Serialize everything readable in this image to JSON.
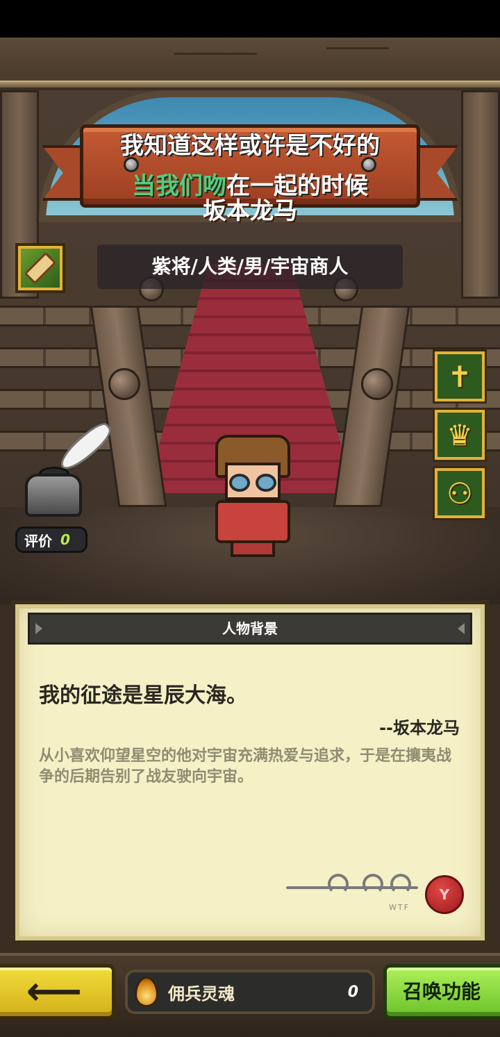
{
  "lyrics": {
    "line1": "我知道这样或许是不好的",
    "line2_highlight": "当我们吻",
    "line2_rest": "在一起的时候"
  },
  "hero": {
    "name": "坂本龙马",
    "info": "紫将/人类/男/宇宙商人"
  },
  "rating": {
    "label": "评价",
    "value": "0"
  },
  "side_icons": [
    {
      "icon": "cross-staff-icon"
    },
    {
      "icon": "crown-up-icon"
    },
    {
      "icon": "goggles-icon"
    }
  ],
  "background_panel": {
    "title": "人物背景",
    "quote": "我的征途是星辰大海。",
    "author": "--坂本龙马",
    "bio": "从小喜欢仰望星空的他对宇宙充满热爱与追求，于是在攘夷战争的后期告别了战友驶向宇宙。",
    "signature_tag": "WTF",
    "seal_letter": "Y"
  },
  "bottom": {
    "soul_label": "佣兵灵魂",
    "soul_value": "0",
    "summon_label": "召唤功能"
  },
  "colors": {
    "lyric_highlight": "#4fd07a",
    "summon_button": "#8ad63a",
    "back_button": "#e6c52a",
    "rating_value": "#b6f048"
  }
}
